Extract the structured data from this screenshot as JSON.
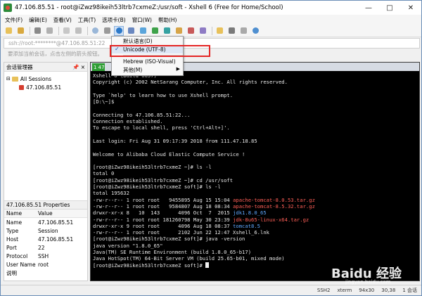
{
  "window": {
    "title": "47.106.85.51 - root@iZwz98ikeih53ltrb7cxmeZ:/usr/soft - Xshell 6 (Free for Home/School)",
    "controls": [
      "—",
      "□",
      "✕"
    ]
  },
  "menu": [
    "文件(F)",
    "编辑(E)",
    "查看(V)",
    "工具(T)",
    "选项卡(B)",
    "窗口(W)",
    "帮助(H)"
  ],
  "address_bar": {
    "value": "ssh://root:********@47.106.85.51:22"
  },
  "hint_bar": {
    "text": "要添加当前会话，点击左侧的箭头按钮。"
  },
  "session_manager": {
    "title": "会话管理器",
    "pin": "📌",
    "close": "×",
    "tree": [
      {
        "label": "All Sessions",
        "type": "folder"
      },
      {
        "label": "47.106.85.51",
        "type": "host"
      }
    ]
  },
  "properties": {
    "title": "47.106.85.51 Properties",
    "header": {
      "name": "Name",
      "value": "Value"
    },
    "rows": [
      {
        "name": "Name",
        "value": "47.106.85.51"
      },
      {
        "name": "Type",
        "value": "Session"
      },
      {
        "name": "Host",
        "value": "47.106.85.51"
      },
      {
        "name": "Port",
        "value": "22"
      },
      {
        "name": "Protocol",
        "value": "SSH"
      },
      {
        "name": "User Name",
        "value": "root"
      },
      {
        "name": "说明",
        "value": ""
      }
    ]
  },
  "tab": {
    "label": "1 47"
  },
  "terminal_lines": [
    {
      "text": "Xshell 6 (Build 0057)",
      "color": "normal"
    },
    {
      "text": "Copyright (c) 2002 NetSarang Computer, Inc. All rights reserved.",
      "color": "normal"
    },
    {
      "text": "",
      "color": "normal"
    },
    {
      "text": "Type `help' to learn how to use Xshell prompt.",
      "color": "normal"
    },
    {
      "text": "[D:\\~]$",
      "color": "normal"
    },
    {
      "text": "",
      "color": "normal"
    },
    {
      "text": "Connecting to 47.106.85.51:22...",
      "color": "normal"
    },
    {
      "text": "Connection established.",
      "color": "normal"
    },
    {
      "text": "To escape to local shell, press 'Ctrl+Alt+]'.",
      "color": "normal"
    },
    {
      "text": "",
      "color": "normal"
    },
    {
      "text": "Last login: Fri Aug 31 09:17:39 2018 from 111.47.18.85",
      "color": "normal"
    },
    {
      "text": "",
      "color": "normal"
    },
    {
      "text": "Welcome to Alibaba Cloud Elastic Compute Service !",
      "color": "normal"
    },
    {
      "text": "",
      "color": "normal"
    },
    {
      "text": "[root@iZwz98ikeih53ltrb7cxmeZ ~]# ls -l",
      "color": "normal"
    },
    {
      "text": "total 0",
      "color": "normal"
    },
    {
      "text": "[root@iZwz98ikeih53ltrb7cxmeZ ~]# cd /usr/soft",
      "color": "normal"
    },
    {
      "text": "[root@iZwz98ikeih53ltrb7cxmeZ soft]# ls -l",
      "color": "normal"
    },
    {
      "text": "total 195632",
      "color": "normal"
    },
    {
      "text": "-rw-r--r-- 1 root root   9455895 Aug 15 15:04 ",
      "hl": "apache-tomcat-8.0.53.tar.gz",
      "color": "red"
    },
    {
      "text": "-rw-r--r-- 1 root root   9584807 Aug 18 08:34 ",
      "hl": "apache-tomcat-8.5.32.tar.gz",
      "color": "red"
    },
    {
      "text": "drwxr-xr-x 8   10  143      4096 Oct  7  2015 ",
      "hl": "jdk1.8.0_65",
      "color": "blue"
    },
    {
      "text": "-rw-r--r-- 1 root root 181260798 May 30 23:39 ",
      "hl": "jdk-8u65-linux-x64.tar.gz",
      "color": "red"
    },
    {
      "text": "drwxr-xr-x 9 root root      4096 Aug 18 08:37 ",
      "hl": "tomcat8.5",
      "color": "blue"
    },
    {
      "text": "-rw-r--r-- 1 root root      2102 Jun 22 12:47 Xshell_6.lnk",
      "color": "normal"
    },
    {
      "text": "[root@iZwz98ikeih53ltrb7cxmeZ soft]# java -version",
      "color": "normal"
    },
    {
      "text": "java version \"1.8.0_65\"",
      "color": "normal"
    },
    {
      "text": "Java(TM) SE Runtime Environment (build 1.8.0_65-b17)",
      "color": "normal"
    },
    {
      "text": "Java HotSpot(TM) 64-Bit Server VM (build 25.65-b01, mixed mode)",
      "color": "normal"
    },
    {
      "text": "[root@iZwz98ikeih53ltrb7cxmeZ soft]# ",
      "color": "normal",
      "cursor": true
    }
  ],
  "encoding_menu": {
    "items": [
      {
        "label": "默认语言(D)",
        "checked": false
      },
      {
        "label": "Unicode (UTF-8)",
        "checked": true
      },
      {
        "label": "Hebrew (ISO-Visual)",
        "checked": false
      },
      {
        "label": "其他(M)",
        "checked": false,
        "submenu": true
      }
    ]
  },
  "status_bar": [
    "SSH2",
    "xterm",
    "94x30",
    "30,38",
    "1 会话"
  ],
  "watermark": {
    "logo": "Baidu 经验",
    "sub": "jingyan.baidu.com"
  },
  "colors": {
    "terminal_bg": "#000000",
    "accent": "#2f9e35",
    "highlight_box": "#e42524",
    "file_red": "#ff5f57",
    "dir_blue": "#5fa8ff"
  }
}
